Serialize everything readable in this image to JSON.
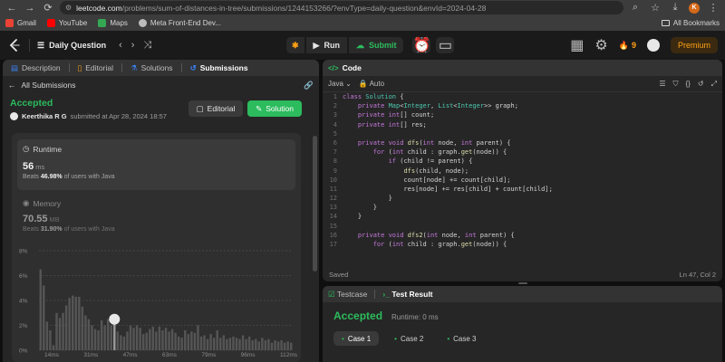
{
  "browser": {
    "url_host": "leetcode.com",
    "url_path": "/problems/sum-of-distances-in-tree/submissions/1244153266/?envType=daily-question&envId=2024-04-28",
    "profile_initial": "K",
    "bookmarks": [
      {
        "label": "Gmail",
        "color": "#ea4335"
      },
      {
        "label": "YouTube",
        "color": "#ff0000"
      },
      {
        "label": "Maps",
        "color": "#34a853"
      },
      {
        "label": "Meta Front-End Dev...",
        "color": "#bbbbbb"
      }
    ],
    "all_bookmarks": "All Bookmarks"
  },
  "top": {
    "title": "Daily Question",
    "run": "Run",
    "submit": "Submit",
    "streak": "9",
    "premium": "Premium"
  },
  "left": {
    "tabs": {
      "description": "Description",
      "editorial": "Editorial",
      "solutions": "Solutions",
      "submissions": "Submissions"
    },
    "back": "All Submissions",
    "status": "Accepted",
    "submitter": "Keerthika R G",
    "submitted_text": "submitted at Apr 28, 2024 18:57",
    "editorial_btn": "Editorial",
    "solution_btn": "Solution",
    "runtime": {
      "label": "Runtime",
      "value": "56",
      "unit": "ms",
      "beats_pre": "Beats",
      "beats_pct": "46.98%",
      "beats_post": "of users with Java"
    },
    "memory": {
      "label": "Memory",
      "value": "70.55",
      "unit": "MB",
      "beats_pre": "Beats",
      "beats_pct": "31.90%",
      "beats_post": "of users with Java"
    }
  },
  "chart_data": {
    "type": "bar",
    "y_ticks": [
      "8%",
      "6%",
      "4%",
      "2%",
      "0%"
    ],
    "ylim": [
      0,
      8
    ],
    "x_ticks": [
      "14ms",
      "31ms",
      "47ms",
      "63ms",
      "79ms",
      "96ms",
      "112ms"
    ],
    "values": [
      6.5,
      5.2,
      2.3,
      1.6,
      0.4,
      3.0,
      2.6,
      3.0,
      3.6,
      4.2,
      4.4,
      4.3,
      4.3,
      3.5,
      2.8,
      2.5,
      2.0,
      1.7,
      1.6,
      2.4,
      2.0,
      2.5,
      2.0,
      2.2,
      1.5,
      1.2,
      1.1,
      1.5,
      2.0,
      1.8,
      2.0,
      1.8,
      1.3,
      1.4,
      1.7,
      1.9,
      1.5,
      1.9,
      1.6,
      1.8,
      1.5,
      1.7,
      1.4,
      1.1,
      1.0,
      1.6,
      1.3,
      1.5,
      1.4,
      2.0,
      1.1,
      1.2,
      0.9,
      1.3,
      1.0,
      1.6,
      1.0,
      1.2,
      0.9,
      1.0,
      1.1,
      1.0,
      0.9,
      1.2,
      0.9,
      1.1,
      0.8,
      0.9,
      0.7,
      1.0,
      0.8,
      0.9,
      0.6,
      0.8,
      0.7,
      0.8,
      0.6,
      0.7,
      0.6
    ],
    "highlight_index": 23
  },
  "code": {
    "tab": "Code",
    "language": "Java",
    "mode": "Auto",
    "lines": [
      "class Solution {",
      "    private Map<Integer, List<Integer>> graph;",
      "    private int[] count;",
      "    private int[] res;",
      "",
      "    private void dfs(int node, int parent) {",
      "        for (int child : graph.get(node)) {",
      "            if (child != parent) {",
      "                dfs(child, node);",
      "                count[node] += count[child];",
      "                res[node] += res[child] + count[child];",
      "            }",
      "        }",
      "    }",
      "",
      "    private void dfs2(int node, int parent) {",
      "        for (int child : graph.get(node)) {"
    ],
    "saved": "Saved",
    "cursor": "Ln 47, Col 2"
  },
  "test": {
    "testcase_tab": "Testcase",
    "result_tab": "Test Result",
    "status": "Accepted",
    "runtime": "Runtime: 0 ms",
    "cases": [
      "Case 1",
      "Case 2",
      "Case 3"
    ]
  }
}
